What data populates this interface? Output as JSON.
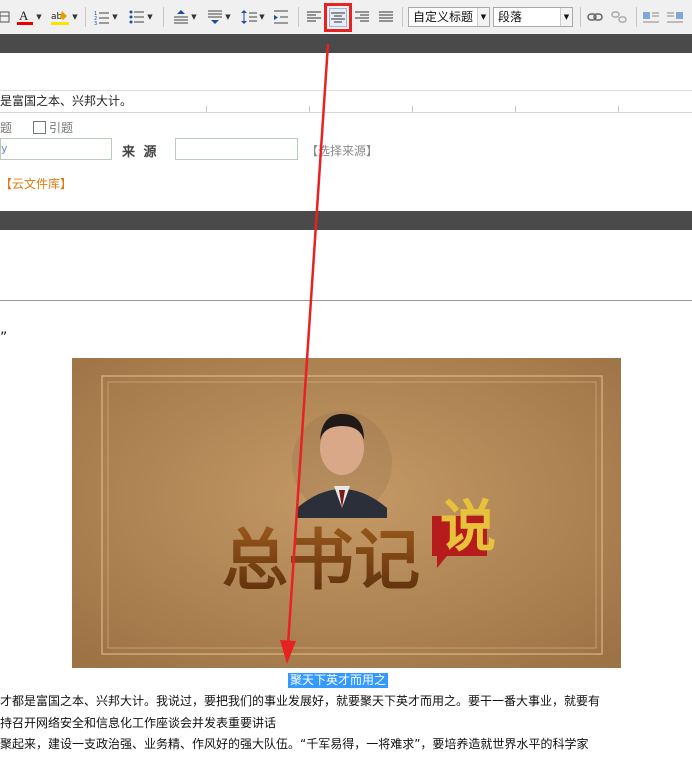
{
  "toolbar": {
    "heading_select": "自定义标题",
    "format_select": "段落",
    "align_center_label": "居中对齐"
  },
  "editor": {
    "first_line": "是富国之本、兴邦大计。",
    "checkbox_label_1": "题",
    "checkbox_label_2": "引题",
    "author_prefix": "y",
    "source_label": "来  源",
    "choose_source_link": "【选择来源】",
    "cloud_library_link": "【云文件库】"
  },
  "content": {
    "quote_mark": "”",
    "image_title_text": "总书记",
    "image_title_badge": "说",
    "caption": "聚天下英才而用之",
    "paragraph_1": "才都是富国之本、兴邦大计。我说过，要把我们的事业发展好，就要聚天下英才而用之。要干一番大事业，就要有",
    "paragraph_2": "持召开网络安全和信息化工作座谈会并发表重要讲话",
    "paragraph_3": "聚起来，建设一支政治强、业务精、作风好的强大队伍。“千军易得，一将难求”，要培养造就世界水平的科学家"
  },
  "colors": {
    "annotation": "#e62222",
    "selection": "#3399ff",
    "orange_link": "#e07a10",
    "dark_bar": "#4a4a4a"
  }
}
